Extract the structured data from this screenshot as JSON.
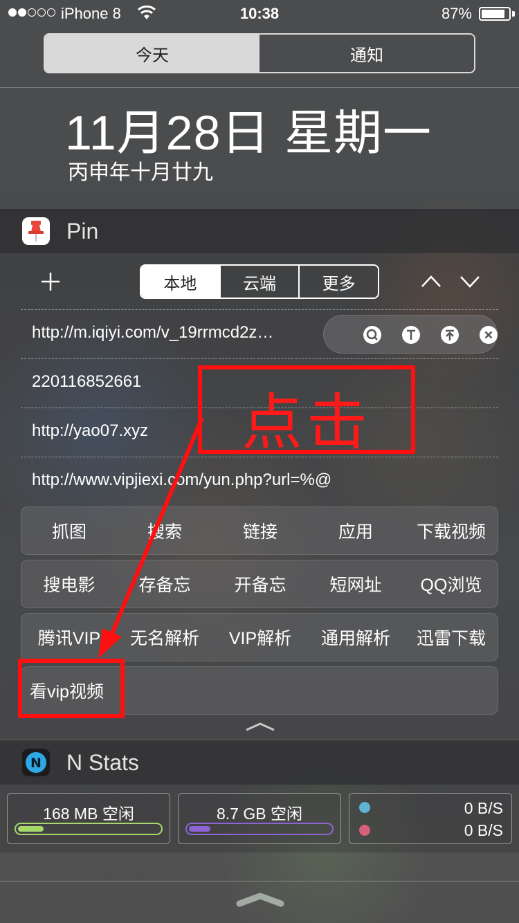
{
  "status_bar": {
    "signal_filled": 2,
    "signal_total": 5,
    "carrier": "iPhone 8",
    "time": "10:38",
    "battery": "87%",
    "battery_level": 0.87
  },
  "top_segment": {
    "tabs": [
      {
        "label": "今天",
        "active": true
      },
      {
        "label": "通知",
        "active": false
      }
    ]
  },
  "date": {
    "main": "11月28日 星期一",
    "lunar": "丙申年十月廿九"
  },
  "pin_widget": {
    "title": "Pin",
    "icon": "pushpin-icon",
    "add_icon": "plus-icon",
    "tabs": [
      {
        "label": "本地",
        "active": true
      },
      {
        "label": "云端",
        "active": false
      },
      {
        "label": "更多",
        "active": false
      }
    ],
    "items": [
      {
        "text": "http://m.iqiyi.com/v_19rrmcd2z…"
      },
      {
        "text": "220116852661"
      },
      {
        "text": "http://yao07.xyz"
      },
      {
        "text": "http://www.vipjiexi.com/yun.php?url=%@"
      }
    ],
    "row_actions": [
      "search-icon",
      "text-icon",
      "upload-icon",
      "close-icon"
    ],
    "buttons": [
      [
        "抓图",
        "搜索",
        "链接",
        "应用",
        "下载视频"
      ],
      [
        "搜电影",
        "存备忘",
        "开备忘",
        "短网址",
        "QQ浏览"
      ],
      [
        "腾讯VIP",
        "无名解析",
        "VIP解析",
        "通用解析",
        "迅雷下载"
      ],
      [
        "看vip视频"
      ]
    ]
  },
  "nstats_widget": {
    "title": "N Stats",
    "icon_letter": "N",
    "memory": {
      "label": "168 MB 空闲",
      "used_fraction": 0.18,
      "color": "#a6d96a"
    },
    "storage": {
      "label": "8.7 GB 空闲",
      "used_fraction": 0.15,
      "color": "#8e63d6"
    },
    "network": {
      "up": {
        "value": "0 B/S",
        "color": "#5fb4d6"
      },
      "down": {
        "value": "0 B/S",
        "color": "#d65f7a"
      }
    }
  },
  "annotation": {
    "label": "点击",
    "color": "#ff1010"
  }
}
